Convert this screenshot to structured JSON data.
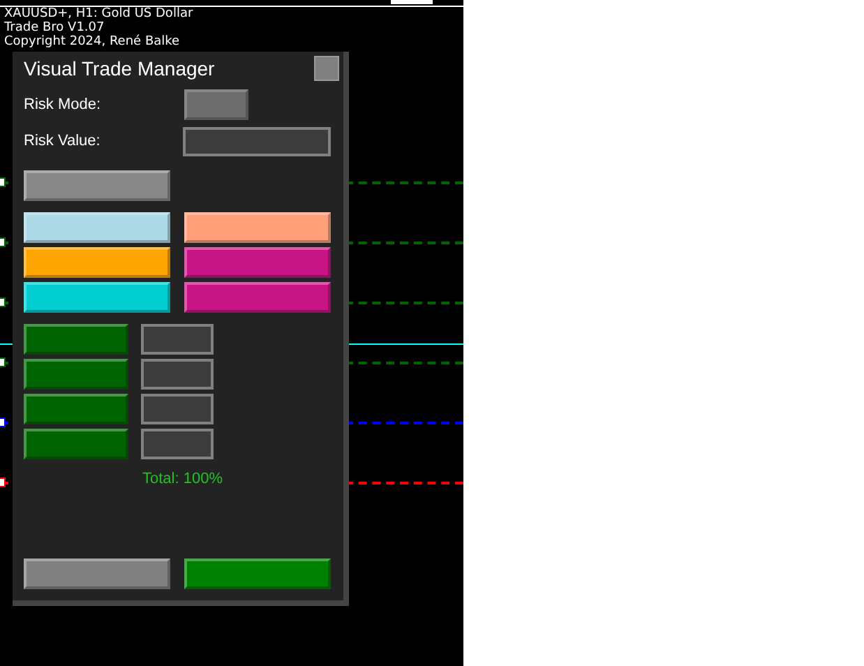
{
  "chart": {
    "header": "XAUUSD+, H1: Gold US Dollar",
    "expert": "Trade Bro V1.07",
    "copyright": "Copyright 2024, René Balke",
    "levels": [
      {
        "kind": "dotted",
        "color": "#006400"
      },
      {
        "kind": "dotted",
        "color": "#006400"
      },
      {
        "kind": "dotted",
        "color": "#006400"
      },
      {
        "kind": "solid",
        "color": "#00ffff"
      },
      {
        "kind": "dotted",
        "color": "#006400"
      },
      {
        "kind": "dotted",
        "color": "#0000ff"
      },
      {
        "kind": "dotted",
        "color": "#ff0000"
      }
    ]
  },
  "panel": {
    "title": "Visual Trade Manager",
    "risk_mode_label": "Risk Mode:",
    "risk_value_label": "Risk Value:",
    "color_buttons": [
      {
        "color": "#add8e6"
      },
      {
        "color": "#ffa07a"
      },
      {
        "color": "#ffa500"
      },
      {
        "color": "#c71585"
      },
      {
        "color": "#00ced1"
      },
      {
        "color": "#c71585"
      }
    ],
    "partials": [
      {
        "color": "#006400"
      },
      {
        "color": "#006400"
      },
      {
        "color": "#006400"
      },
      {
        "color": "#006400"
      }
    ],
    "total": "Total: 100%",
    "footer_buttons": [
      {
        "color": "#808080"
      },
      {
        "color": "#008000"
      }
    ]
  }
}
